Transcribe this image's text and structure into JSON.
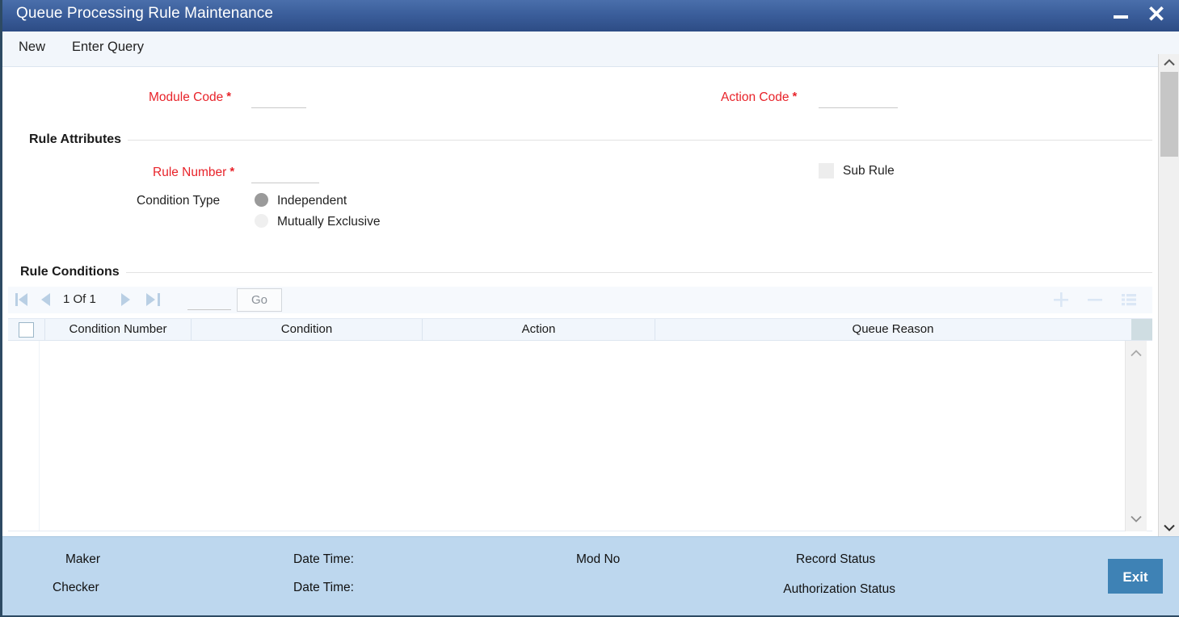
{
  "window": {
    "title": "Queue Processing Rule Maintenance",
    "minimize_label": "minimize",
    "close_label": "close"
  },
  "menubar": {
    "new_label": "New",
    "enter_query_label": "Enter Query"
  },
  "form": {
    "module_code": {
      "label": "Module Code",
      "required_mark": "*",
      "value": "",
      "placeholder": ""
    },
    "action_code": {
      "label": "Action Code",
      "required_mark": "*",
      "value": "",
      "placeholder": ""
    }
  },
  "rule_attributes": {
    "section_title": "Rule Attributes",
    "rule_number": {
      "label": "Rule Number",
      "required_mark": "*",
      "value": "",
      "placeholder": ""
    },
    "condition_type": {
      "label": "Condition Type",
      "options": [
        {
          "label": "Independent",
          "selected": true
        },
        {
          "label": "Mutually Exclusive",
          "selected": false
        }
      ]
    },
    "sub_rule": {
      "label": "Sub Rule",
      "checked": false
    }
  },
  "rule_conditions": {
    "section_title": "Rule Conditions",
    "pager": {
      "first_icon": "first-page-icon",
      "prev_icon": "previous-page-icon",
      "page_text": "1 Of 1",
      "next_icon": "next-page-icon",
      "last_icon": "last-page-icon",
      "jump_value": "",
      "go_label": "Go"
    },
    "tools": [
      {
        "name": "add-row-button",
        "icon": "plus-icon"
      },
      {
        "name": "delete-row-button",
        "icon": "minus-icon"
      },
      {
        "name": "single-row-view-button",
        "icon": "list-icon"
      }
    ],
    "columns": [
      {
        "label": "Condition Number"
      },
      {
        "label": "Condition"
      },
      {
        "label": "Action"
      },
      {
        "label": "Queue Reason"
      }
    ],
    "rows": []
  },
  "footer": {
    "maker_label": "Maker",
    "maker_datetime_label": "Date Time:",
    "checker_label": "Checker",
    "checker_datetime_label": "Date Time:",
    "mod_no_label": "Mod No",
    "record_status_label": "Record Status",
    "authorization_status_label": "Authorization Status",
    "exit_label": "Exit"
  },
  "colors": {
    "titlebar_top": "#4a6fab",
    "titlebar_bottom": "#2d4c85",
    "required_red": "#e8232a",
    "footer_bg": "#bdd7ee",
    "exit_button": "#3e82b5",
    "grid_header_bg": "#f1f6fc"
  }
}
